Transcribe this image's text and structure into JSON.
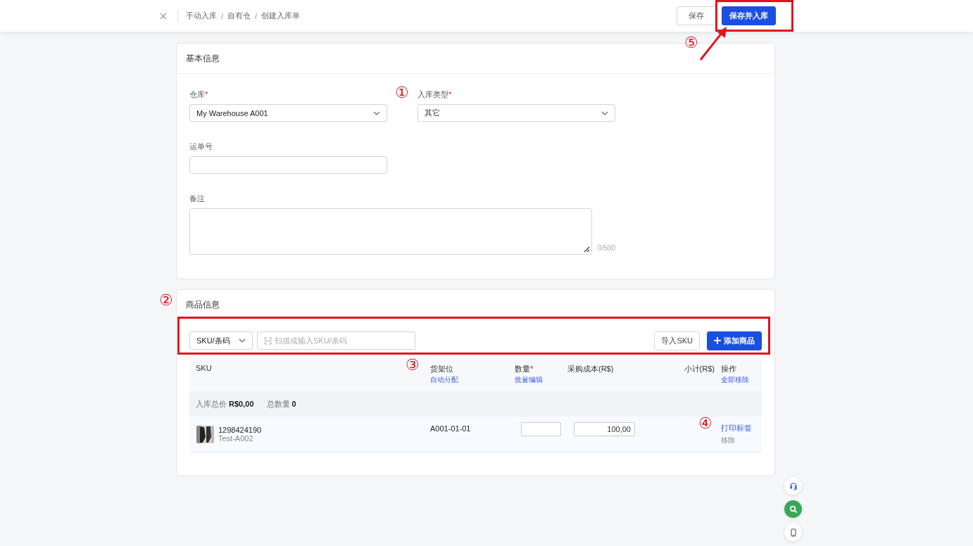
{
  "breadcrumb": [
    "手动入库",
    "自有仓",
    "创建入库单"
  ],
  "breadcrumb_separator": "/",
  "required_mark": "*",
  "actions": [
    {
      "label": "保存",
      "kind": "default"
    },
    {
      "label": "保存并入库",
      "kind": "primary"
    }
  ],
  "basic_info": {
    "title": "基本信息",
    "fields": [
      {
        "label": "仓库",
        "required": true,
        "kind": "select",
        "value": "My Warehouse A001"
      },
      {
        "label": "入库类型",
        "required": true,
        "kind": "select",
        "value": "其它"
      },
      {
        "label": "运单号",
        "required": false,
        "kind": "input"
      },
      {
        "label": "备注",
        "required": false,
        "kind": "textarea",
        "counter": "0/500"
      }
    ]
  },
  "goods_info": {
    "title": "商品信息",
    "search_type": "SKU/条码",
    "search_placeholder": "扫描或输入SKU/条码",
    "import_button": "导入SKU",
    "add_button": "添加商品",
    "columns": [
      {
        "label": "SKU",
        "required": false
      },
      {
        "label": "货架位",
        "required": false,
        "link": "自动分配"
      },
      {
        "label": "数量",
        "required": true,
        "link": "批量编辑"
      },
      {
        "label": "采购成本(R$)",
        "required": false
      },
      {
        "label": "小计(R$)",
        "required": false
      },
      {
        "label": "操作",
        "required": false,
        "link": "全部移除"
      }
    ],
    "summary": {
      "total_price_label": "入库总价",
      "total_price": "R$0,00",
      "total_qty_label": "总数量",
      "total_qty": "0"
    },
    "rows": [
      {
        "sku": "1298424190",
        "name": "Test-A002",
        "shelf": "A001-01-01",
        "cost": "100,00",
        "print_link": "打印标签",
        "remove_link": "移除"
      }
    ]
  },
  "annotations": [
    {
      "label": "①"
    },
    {
      "label": "②"
    },
    {
      "label": "③"
    },
    {
      "label": "④"
    },
    {
      "label": "⑤"
    }
  ]
}
